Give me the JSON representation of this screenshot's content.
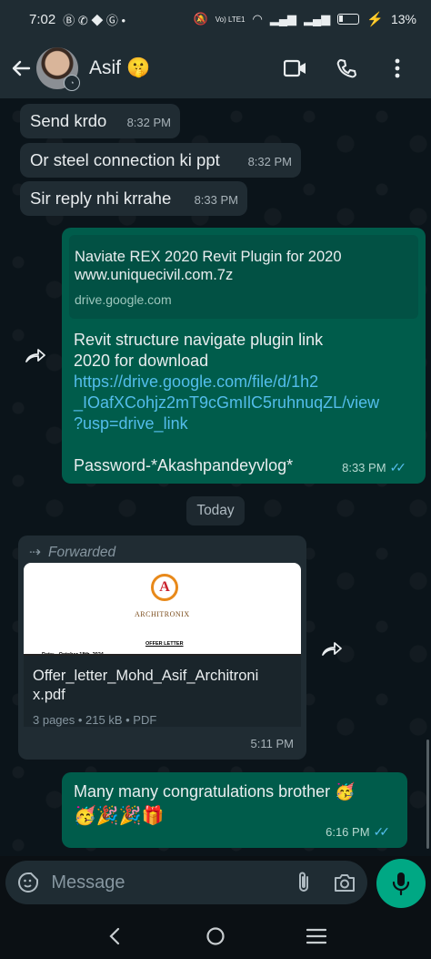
{
  "status_bar": {
    "time": "7:02",
    "battery": "13%",
    "network": "Vo) LTE1"
  },
  "header": {
    "contact_name": "Asif",
    "contact_emoji": "🤫"
  },
  "messages": [
    {
      "direction": "incoming",
      "text": "Send krdo",
      "time": "8:32 PM"
    },
    {
      "direction": "incoming",
      "text": "Or steel connection ki ppt",
      "time": "8:32 PM"
    },
    {
      "direction": "incoming",
      "text": "Sir reply nhi krrahe",
      "time": "8:33 PM"
    },
    {
      "direction": "outgoing",
      "preview_title": "Naviate REX 2020 Revit Plugin for 2020 www.uniquecivil.com.7z",
      "preview_domain": "drive.google.com",
      "text_line1": "Revit structure navigate plugin link",
      "text_line2": "2020 for download",
      "link": "https://drive.google.com/file/d/1h2_IOafXCohjz2mT9cGmIlC5ruhnuqZL/view?usp=drive_link",
      "link_line1": "https://drive.google.com/file/d/1h2",
      "link_line2": "_IOafXCohjz2mT9cGmIlC5ruhnuqZL/view",
      "link_line3": "?usp=drive_link",
      "password": "Password-*Akashpandeyvlog*",
      "time": "8:33 PM"
    }
  ],
  "day_divider": "Today",
  "document_message": {
    "forwarded_label": "Forwarded",
    "thumb_logo_letter": "A",
    "thumb_brand": "ARCHITRONIX",
    "thumb_heading": "OFFER LETTER",
    "thumb_date": "Date: - October 18th, 2024",
    "file_name_line1": "Offer_letter_Mohd_Asif_Architroni",
    "file_name_line2": "x.pdf",
    "meta": "3 pages • 215 kB • PDF",
    "time": "5:11 PM"
  },
  "last_message": {
    "text": "Many many congratulations brother 🥳",
    "emojis": "🥳🎉🎉🎁",
    "time": "6:16 PM"
  },
  "input": {
    "placeholder": "Message"
  }
}
